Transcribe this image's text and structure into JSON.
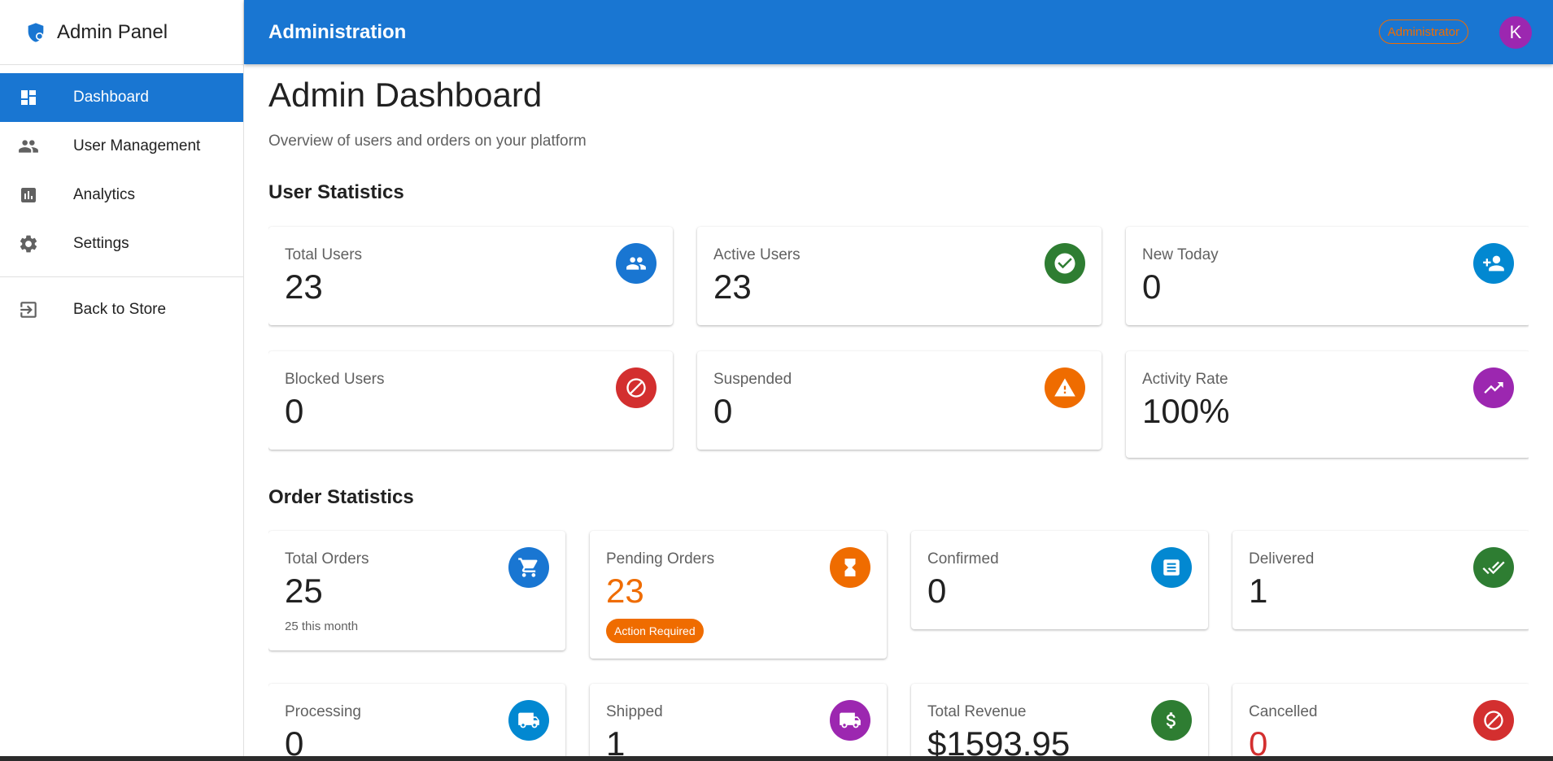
{
  "app": {
    "brand": "Admin Panel",
    "top_title": "Administration",
    "role": "Administrator",
    "avatar_initial": "K"
  },
  "sidebar": {
    "items": [
      {
        "label": "Dashboard",
        "icon": "dashboard-icon",
        "active": true
      },
      {
        "label": "User Management",
        "icon": "people-icon"
      },
      {
        "label": "Analytics",
        "icon": "analytics-icon"
      },
      {
        "label": "Settings",
        "icon": "gear-icon"
      }
    ],
    "back": {
      "label": "Back to Store",
      "icon": "exit-icon"
    }
  },
  "page": {
    "title": "Admin Dashboard",
    "subtitle": "Overview of users and orders on your platform"
  },
  "user_stats": {
    "title": "User Statistics",
    "cards": [
      {
        "label": "Total Users",
        "value": "23",
        "icon": "people-icon",
        "color": "#1976d2"
      },
      {
        "label": "Active Users",
        "value": "23",
        "icon": "check-circle-icon",
        "color": "#2e7d32"
      },
      {
        "label": "New Today",
        "value": "0",
        "icon": "person-add-icon",
        "color": "#0288d1"
      },
      {
        "label": "Blocked Users",
        "value": "0",
        "icon": "block-icon",
        "color": "#d32f2f"
      },
      {
        "label": "Suspended",
        "value": "0",
        "icon": "warning-icon",
        "color": "#ef6c00"
      },
      {
        "label": "Activity Rate",
        "value": "100%",
        "icon": "trending-up-icon",
        "color": "#9c27b0"
      }
    ]
  },
  "order_stats": {
    "title": "Order Statistics",
    "cards": [
      {
        "label": "Total Orders",
        "value": "25",
        "sub": "25 this month",
        "icon": "cart-icon",
        "color": "#1976d2"
      },
      {
        "label": "Pending Orders",
        "value": "23",
        "chip": "Action Required",
        "icon": "hourglass-icon",
        "color": "#ef6c00"
      },
      {
        "label": "Confirmed",
        "value": "0",
        "icon": "receipt-icon",
        "color": "#0288d1"
      },
      {
        "label": "Delivered",
        "value": "1",
        "icon": "done-all-icon",
        "color": "#2e7d32"
      },
      {
        "label": "Processing",
        "value": "0",
        "icon": "truck-icon",
        "color": "#0288d1"
      },
      {
        "label": "Shipped",
        "value": "1",
        "icon": "truck-icon",
        "color": "#9c27b0"
      },
      {
        "label": "Total Revenue",
        "value": "$1593.95",
        "icon": "dollar-icon",
        "color": "#2e7d32"
      },
      {
        "label": "Cancelled",
        "value": "0",
        "icon": "block-icon",
        "color": "#d32f2f"
      }
    ]
  }
}
